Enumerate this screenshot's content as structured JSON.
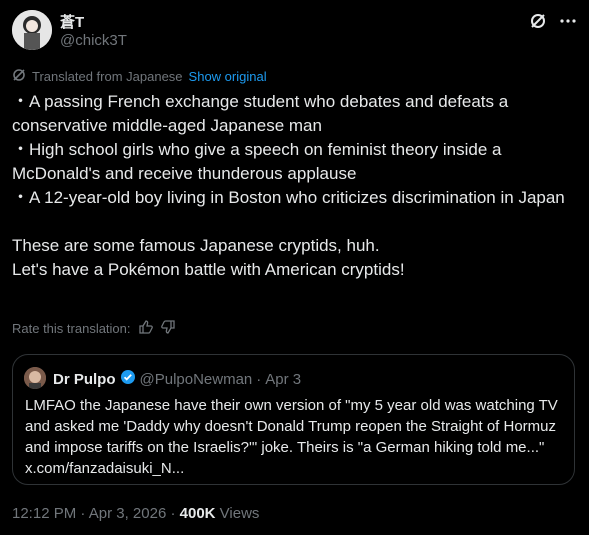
{
  "author": {
    "name": "蒼T",
    "handle": "@chick3T"
  },
  "translation": {
    "notice": "Translated from Japanese",
    "show_original": "Show original",
    "rate_label": "Rate this translation:"
  },
  "tweet_text": "・A passing French exchange student who debates and defeats a conservative middle-aged Japanese man\n・High school girls who give a speech on feminist theory inside a McDonald's and receive thunderous applause\n・A 12-year-old boy living in Boston who criticizes discrimination in Japan\n\nThese are some famous Japanese cryptids, huh.\nLet's have a Pokémon battle with American cryptids!",
  "quote": {
    "name": "Dr Pulpo",
    "handle": "@PulpoNewman",
    "separator": "·",
    "date": "Apr 3",
    "text": "LMFAO the Japanese have their own version of \"my 5 year old was watching TV and asked me 'Daddy why doesn't Donald Trump reopen the Straight of Hormuz and impose tariffs on the Israelis?'\" joke. Theirs is \"a German hiking told me...\" x.com/fanzadaisuki_N..."
  },
  "footer": {
    "time": "12:12 PM",
    "separator": "·",
    "date": "Apr 3, 2026",
    "separator2": "·",
    "views_count": "400K",
    "views_label": "Views"
  },
  "colors": {
    "background": "#000000",
    "text": "#e7e9ea",
    "secondary": "#71767b",
    "link": "#1d9bf0",
    "border": "#2f3336"
  }
}
